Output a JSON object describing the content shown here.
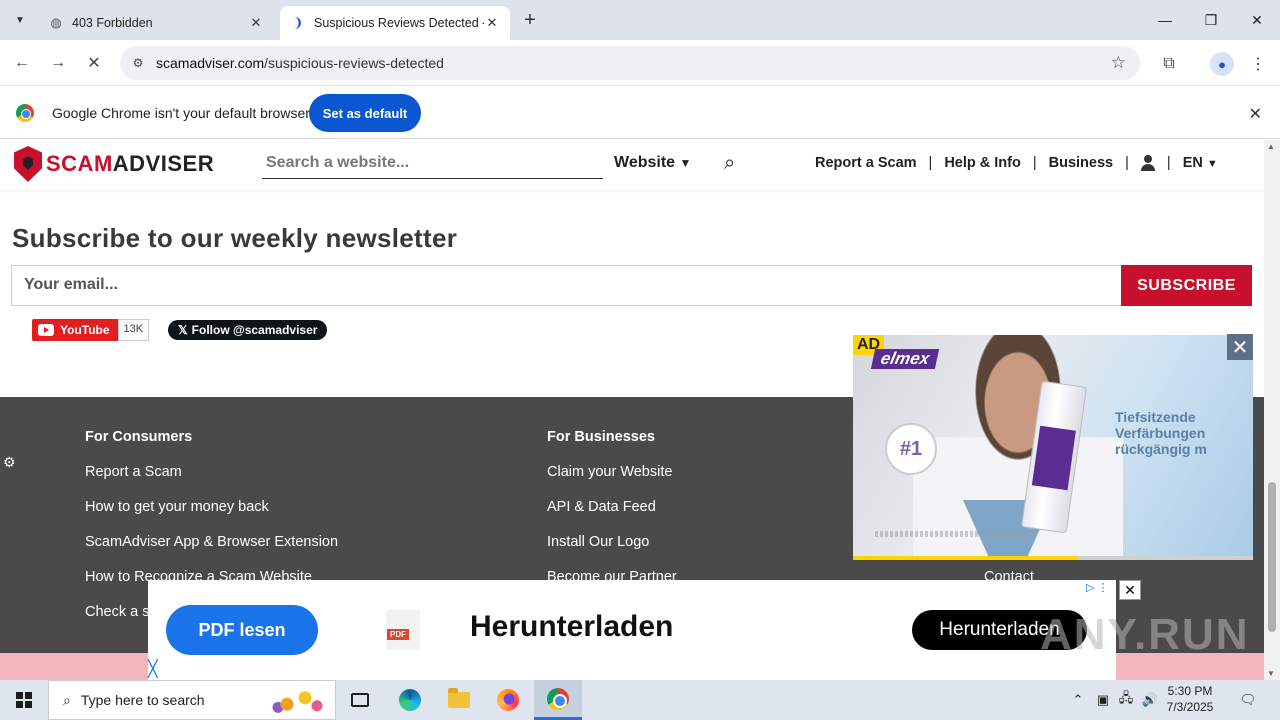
{
  "browser": {
    "tabs": [
      {
        "title": "403 Forbidden",
        "active": false
      },
      {
        "title": "Suspicious Reviews Detected - S",
        "active": true
      }
    ],
    "url_domain": "scamadviser.com",
    "url_path": "/suspicious-reviews-detected",
    "infobar": {
      "message": "Google Chrome isn't your default browser",
      "button": "Set as default"
    }
  },
  "site": {
    "logo_scam": "SCAM",
    "logo_adviser": "ADVISER",
    "search_placeholder": "Search a website...",
    "search_type": "Website",
    "nav": [
      "Report a Scam",
      "Help & Info",
      "Business"
    ],
    "language": "EN"
  },
  "newsletter": {
    "title": "Subscribe to our weekly newsletter",
    "email_placeholder": "Your email...",
    "subscribe": "SUBSCRIBE"
  },
  "social": {
    "youtube_label": "YouTube",
    "youtube_count": "13K",
    "twitter_follow": "Follow @scamadviser"
  },
  "footer": {
    "consumers_heading": "For Consumers",
    "consumers_links": [
      "Report a Scam",
      "How to get your money back",
      "ScamAdviser App & Browser Extension",
      "How to Recognize a Scam Website",
      "Check a s"
    ],
    "business_heading": "For Businesses",
    "business_links": [
      "Claim your Website",
      "API & Data Feed",
      "Install Our Logo",
      "Become our Partner"
    ],
    "contact": "Contact"
  },
  "ads": {
    "elmex": {
      "ad_label": "AD",
      "brand": "elmex",
      "seal_number": "#1",
      "claim_lines": [
        "Tiefsitzende",
        "Verfärbungen",
        "rückgängig m"
      ],
      "progress": 0.56
    },
    "bottom": {
      "pdf_button": "PDF lesen",
      "pdf_icon_label": "PDF",
      "headline": "Herunterladen",
      "download_button": "Herunterladen"
    }
  },
  "watermark": "ANY.RUN",
  "taskbar": {
    "search_placeholder": "Type here to search",
    "time": "5:30 PM",
    "date": "7/3/2025"
  },
  "colors": {
    "brand_red": "#c8102e",
    "chrome_blue": "#0b57d0",
    "footer_bg": "#4a4a4a"
  }
}
